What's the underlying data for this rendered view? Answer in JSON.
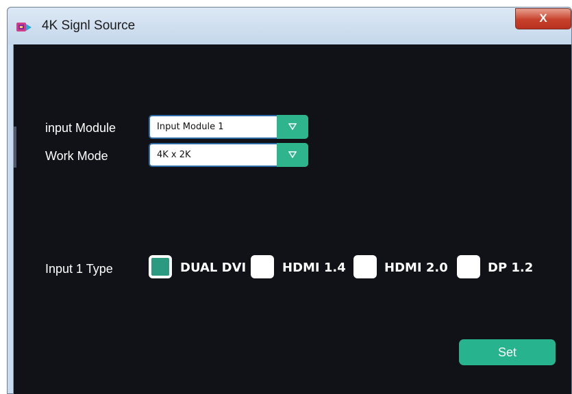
{
  "window": {
    "title": "4K Signl Source",
    "close_label": "X"
  },
  "form": {
    "input_module": {
      "label": "input Module",
      "value": "Input Module 1"
    },
    "work_mode": {
      "label": "Work Mode",
      "value": "4K x 2K"
    },
    "input_type": {
      "label": "Input 1 Type",
      "options": [
        {
          "label": "DUAL DVI",
          "checked": true
        },
        {
          "label": "HDMI 1.4",
          "checked": false
        },
        {
          "label": "HDMI 2.0",
          "checked": false
        },
        {
          "label": "DP 1.2",
          "checked": false
        }
      ]
    },
    "set_label": "Set"
  },
  "colors": {
    "accent": "#2fb58e",
    "background": "#111218",
    "checked_fill": "#2b9a80"
  },
  "icons": {
    "app": "app-logo-icon",
    "dropdown": "chevron-down-icon"
  }
}
